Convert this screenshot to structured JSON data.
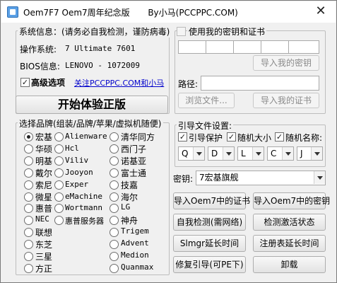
{
  "window": {
    "title": "Oem7F7 Oem7周年纪念版",
    "author": "By小马(PCCPPC.COM)",
    "close_glyph": "✕"
  },
  "sysinfo": {
    "legend": "系统信息：(请务必自我检测，谨防病毒)",
    "os_label": "操作系统:",
    "os_value": "7 Ultimate 7601",
    "bios_label": "BIOS信息:",
    "bios_value": "LENOVO - 1072009",
    "advanced_label": "高级选项",
    "advanced_checked": true,
    "follow_link": "关注PCCPPC.COM和小马",
    "start_button": "开始体验正版"
  },
  "brands": {
    "legend": "选择品牌(组装/品牌/苹果/虚拟机随便)",
    "col1": [
      {
        "label": "宏基",
        "checked": true
      },
      {
        "label": "华硕"
      },
      {
        "label": "明基"
      },
      {
        "label": "戴尔"
      },
      {
        "label": "索尼"
      },
      {
        "label": "微星"
      },
      {
        "label": "惠普"
      },
      {
        "label": "NEC"
      },
      {
        "label": "联想"
      },
      {
        "label": "东芝"
      },
      {
        "label": "三星"
      },
      {
        "label": "方正"
      }
    ],
    "col2": [
      {
        "label": "Alienware"
      },
      {
        "label": "Hcl"
      },
      {
        "label": "Viliv"
      },
      {
        "label": "Jooyon"
      },
      {
        "label": "Exper"
      },
      {
        "label": "eMachine"
      },
      {
        "label": "Wortmann"
      },
      {
        "label": "惠普服务器"
      }
    ],
    "col3": [
      {
        "label": "清华同方"
      },
      {
        "label": "西门子"
      },
      {
        "label": "诺基亚"
      },
      {
        "label": "富士通"
      },
      {
        "label": "技嘉"
      },
      {
        "label": "海尔"
      },
      {
        "label": "LG"
      },
      {
        "label": "神舟"
      },
      {
        "label": "Trigem"
      },
      {
        "label": "Advent"
      },
      {
        "label": "Medion"
      },
      {
        "label": "Quanmax"
      }
    ]
  },
  "keycert": {
    "legend": "使用我的密钥和证书",
    "import_key_button": "导入我的密钥",
    "path_label": "路径:",
    "browse_button": "浏览文件...",
    "import_cert_button": "导入我的证书"
  },
  "bootfile": {
    "legend": "引导文件设置:",
    "opt_protect": "引导保护",
    "opt_random_size": "随机大小",
    "opt_random_name": "随机名称:",
    "drives": [
      "Q",
      "D",
      "L",
      "C",
      "J"
    ]
  },
  "key": {
    "label": "密钥:",
    "selected": "7宏基旗舰"
  },
  "actions": {
    "import_oem7_cert": "导入Oem7中的证书",
    "import_oem7_key": "导入Oem7中的密钥",
    "self_check": "自我检测(需网络)",
    "check_activation": "检测激活状态",
    "slmgr_extend": "Slmgr延长时间",
    "registry_extend": "注册表延长时间",
    "repair_boot": "修复引导(可PE下)",
    "uninstall": "卸载"
  }
}
